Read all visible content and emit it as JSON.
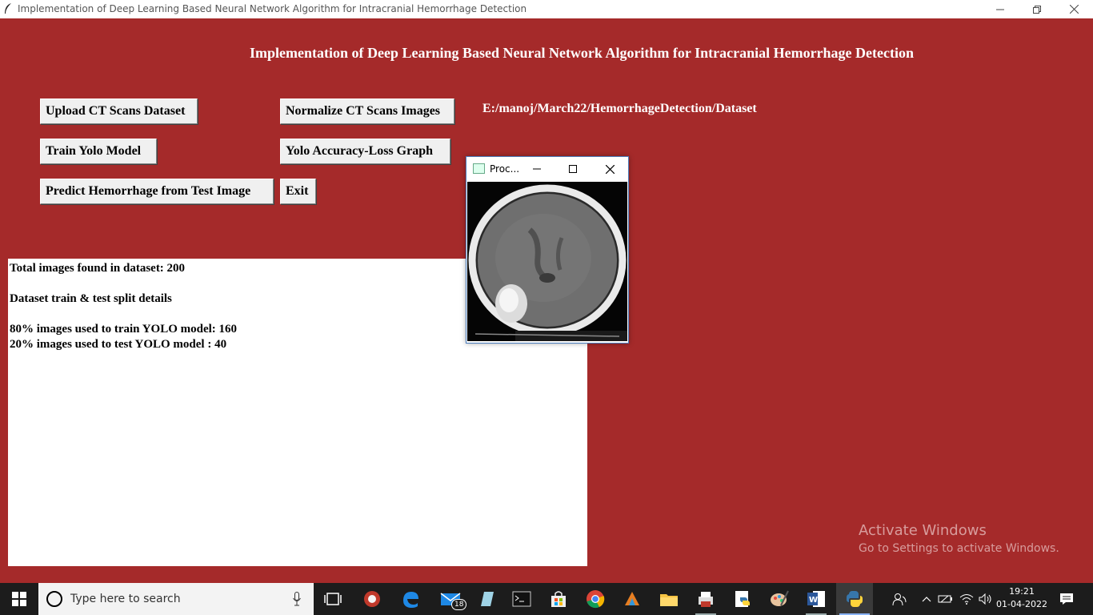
{
  "window": {
    "title": "Implementation of Deep Learning Based Neural Network Algorithm for Intracranial Hemorrhage Detection"
  },
  "app": {
    "heading": "Implementation of Deep Learning Based Neural Network Algorithm for Intracranial Hemorrhage Detection",
    "buttons": {
      "upload": "Upload CT Scans Dataset",
      "normalize": "Normalize CT Scans Images",
      "train": "Train Yolo Model",
      "graph": "Yolo Accuracy-Loss Graph",
      "predict": "Predict Hemorrhage from Test Image",
      "exit": "Exit"
    },
    "dataset_path": "E:/manoj/March22/HemorrhageDetection/Dataset",
    "output_lines": [
      "Total images found in dataset: 200",
      "",
      "Dataset train & test split details",
      "",
      "80% images used to train YOLO model: 160",
      "20% images used to test YOLO model : 40"
    ]
  },
  "popup": {
    "title": "Proc..."
  },
  "watermark": {
    "line1": "Activate Windows",
    "line2": "Go to Settings to activate Windows."
  },
  "taskbar": {
    "search_placeholder": "Type here to search",
    "mail_badge": "18",
    "time": "19:21",
    "date": "01-04-2022"
  },
  "colors": {
    "background": "#a52a2a",
    "button_face": "#f0f0f0",
    "taskbar": "#1c1c1c"
  }
}
